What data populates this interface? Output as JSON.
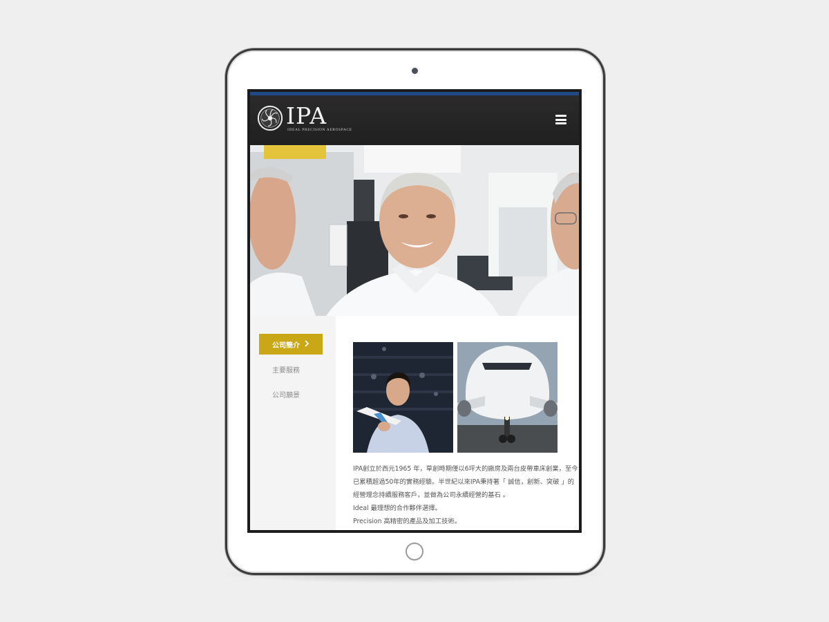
{
  "brand": {
    "name": "IPA",
    "tagline": "IDEAL PRECISION AEROSPACE"
  },
  "header": {
    "menu_icon": "hamburger-menu-icon"
  },
  "sidebar": {
    "items": [
      {
        "label": "公司簡介",
        "active": true
      },
      {
        "label": "主要服務",
        "active": false
      },
      {
        "label": "公司願景",
        "active": false
      }
    ]
  },
  "content": {
    "paragraphs": [
      "IPA創立於西元1965 年，草創時期僅以6坪大的廠房及兩台皮帶車床創業，至今",
      "已累積超過50年的實務經驗。半世紀以來IPA秉持著「 誠信，創新、突破 」的",
      "經營理念持續服務客戶，並做為公司永續經營的基石 。",
      "Ideal 最理想的合作夥伴選擇。",
      "Precision 高精密的產品及加工技術。"
    ]
  },
  "colors": {
    "accent": "#c9a716",
    "topbar": "#1f4a86",
    "header_bg": "#252525"
  }
}
